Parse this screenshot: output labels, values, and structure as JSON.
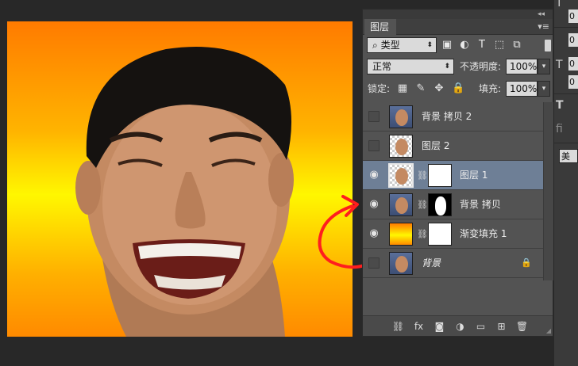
{
  "canvas": {
    "description_alt": "portrait",
    "gradient_colors": [
      "#ff7b00",
      "#fff700",
      "#ff8a00"
    ]
  },
  "layers_panel": {
    "tab_label": "图层",
    "collapse_glyph": "◂◂",
    "menu_glyph": "▾≡",
    "filter": {
      "selected": "类型",
      "search_glyph": "⌕"
    },
    "filter_icons": [
      "image-filter-icon",
      "adjustment-filter-icon",
      "type-filter-icon",
      "shape-filter-icon",
      "smart-object-filter-icon"
    ],
    "filter_icon_glyphs": [
      "▣",
      "◐",
      "T",
      "⬚",
      "⧉"
    ],
    "blend_mode": "正常",
    "opacity_label": "不透明度:",
    "opacity_value": "100%",
    "lock_label": "锁定:",
    "lock_glyphs": [
      "▦",
      "✎",
      "✥",
      "🔒"
    ],
    "fill_label": "填充:",
    "fill_value": "100%",
    "layers": [
      {
        "name": "背景 拷贝 2",
        "visible": false,
        "selected": false,
        "thumb": "photo",
        "mask": null
      },
      {
        "name": "图层 2",
        "visible": false,
        "selected": false,
        "thumb": "checker",
        "mask": null
      },
      {
        "name": "图层 1",
        "visible": true,
        "selected": true,
        "thumb": "checker",
        "mask": "white"
      },
      {
        "name": "背景 拷贝",
        "visible": true,
        "selected": false,
        "thumb": "photo",
        "mask": "black"
      },
      {
        "name": "渐变填充 1",
        "visible": true,
        "selected": false,
        "thumb": "gradient",
        "mask": "white"
      },
      {
        "name": "背景",
        "visible": false,
        "selected": false,
        "thumb": "photo",
        "mask": null,
        "locked": true
      }
    ],
    "eye_glyph": "👁",
    "chain_glyph": "⛓",
    "lock_glyph": "🔒",
    "bottom_icons": [
      "link-layers-icon",
      "fx-icon",
      "add-mask-icon",
      "adjustment-layer-icon",
      "new-group-icon",
      "new-layer-icon",
      "trash-icon"
    ],
    "bottom_glyphs": [
      "⛓",
      "fx",
      "◙",
      "◑",
      "▭",
      "⊞",
      "🗑"
    ]
  },
  "right_strip": {
    "boxes": [
      "0",
      "0",
      "0",
      "0",
      "0"
    ],
    "glyphs": [
      "T",
      "T"
    ],
    "partial_label": "fi",
    "button_label": "美国"
  },
  "annotation_color": "#ff1e1e"
}
